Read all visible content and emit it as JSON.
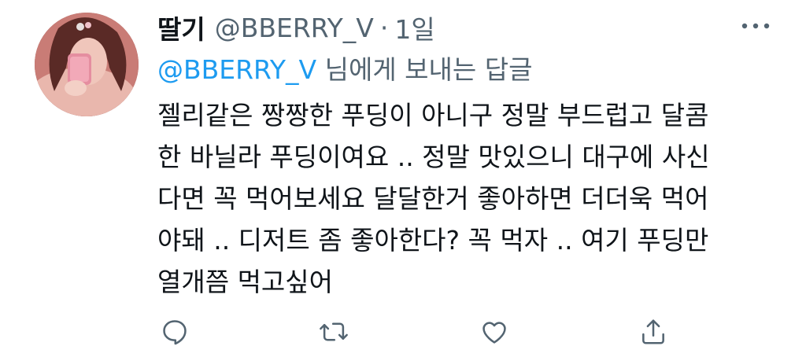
{
  "tweet": {
    "display_name": "딸기",
    "handle": "@BBERRY_V",
    "separator": "·",
    "time": "1일",
    "reply_to": {
      "mention": "@BBERRY_V",
      "suffix": " 님에게 보내는 답글"
    },
    "lines": [
      "젤리같은 짱짱한 푸딩이 아니구 정말 부드럽고 달콤",
      "한 바닐라 푸딩이여요 .. 정말 맛있으니 대구에 사신",
      "다면 꼭 먹어보세요 달달한거 좋아하면 더더욱 먹어",
      "야돼 .. 디저트 좀 좋아한다? 꼭 먹자 .. 여기 푸딩만",
      "열개쯤 먹고싶어"
    ]
  },
  "icons": {
    "more": "more-dots-icon",
    "reply": "reply-icon",
    "retweet": "retweet-icon",
    "like": "heart-icon",
    "share": "share-icon"
  },
  "colors": {
    "text": "#0f1419",
    "secondary": "#536471",
    "accent": "#1d9bf0"
  }
}
